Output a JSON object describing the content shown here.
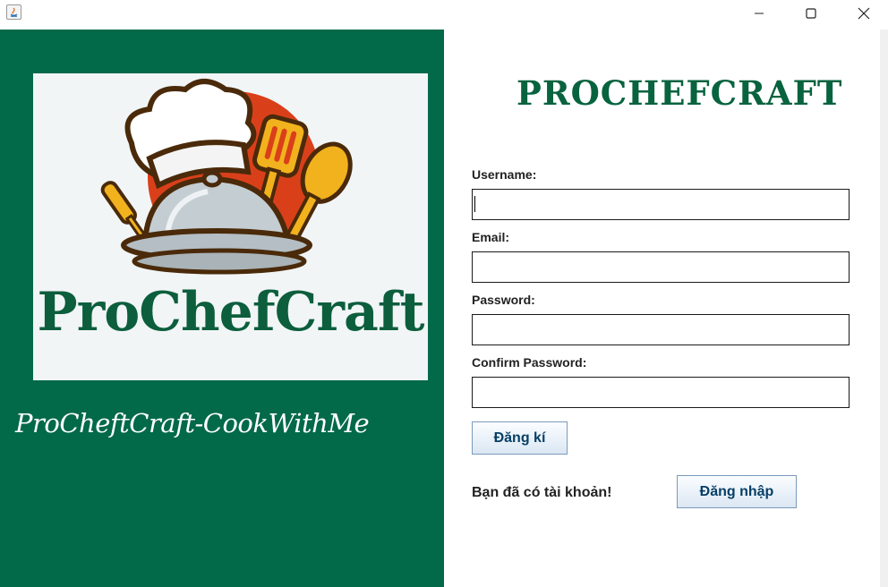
{
  "window": {
    "icons": {
      "app": "java-app-icon",
      "minimize": "minimize-icon",
      "maximize": "maximize-icon",
      "close": "close-icon"
    }
  },
  "branding": {
    "logo_text": "ProChefCraft",
    "tagline": "ProCheftCraft-CookWithMe",
    "logo_icon": "chef-hat-cloche-icon"
  },
  "form": {
    "title": "PROCHEFCRAFT",
    "fields": [
      {
        "label": "Username:",
        "value": ""
      },
      {
        "label": "Email:",
        "value": ""
      },
      {
        "label": "Password:",
        "value": ""
      },
      {
        "label": "Confirm Password:",
        "value": ""
      }
    ],
    "register_button": "Đăng kí",
    "have_account_text": "Bạn đã có tài khoản!",
    "login_button": "Đăng nhập"
  },
  "colors": {
    "brand_green": "#026949",
    "title_green": "#08633f",
    "logo_orange": "#d9401a",
    "logo_gold": "#f2b21d"
  }
}
